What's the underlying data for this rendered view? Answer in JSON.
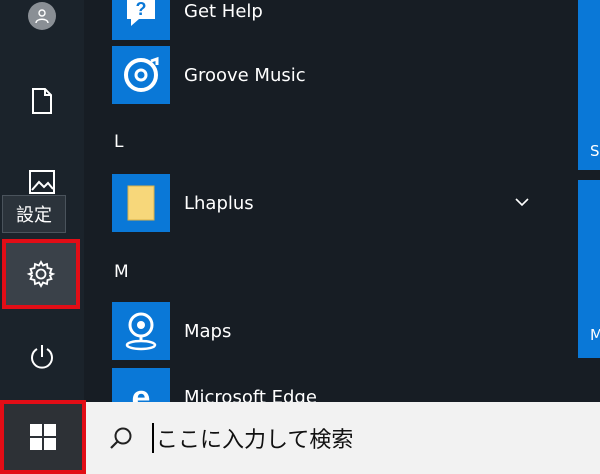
{
  "rail": {
    "account_icon": "user-icon",
    "documents_icon": "document-icon",
    "pictures_icon": "pictures-icon",
    "settings_tooltip": "設定",
    "settings_icon": "gear-icon",
    "power_icon": "power-icon"
  },
  "apps": {
    "items": [
      {
        "label": "Get Help",
        "icon": "help-icon"
      },
      {
        "label": "Groove Music",
        "icon": "groove-icon"
      },
      {
        "label": "Lhaplus",
        "icon": "folder-icon"
      },
      {
        "label": "Maps",
        "icon": "map-pin-icon"
      },
      {
        "label": "Microsoft Edge",
        "icon": "edge-icon"
      }
    ],
    "letters": [
      "L",
      "M"
    ]
  },
  "live_tiles": {
    "tile_a_text": "S",
    "tile_b_text": "M"
  },
  "taskbar": {
    "start_icon": "windows-icon",
    "search_icon": "search-icon",
    "search_placeholder": "ここに入力して検索"
  },
  "colors": {
    "accent": "#0a78d7",
    "highlight": "#e20d16",
    "background": "#171d24"
  }
}
